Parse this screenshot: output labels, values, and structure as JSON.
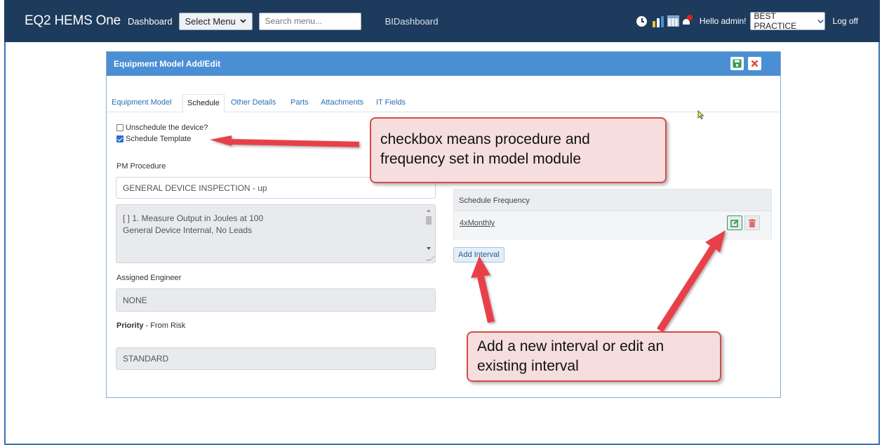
{
  "navbar": {
    "brand": "EQ2 HEMS One",
    "dashboard": "Dashboard",
    "select_menu": "Select Menu",
    "search_placeholder": "Search menu...",
    "bi_dashboard": "BIDashboard",
    "hello": "Hello admin!",
    "facility": "BEST PRACTICE",
    "log_off": "Log off"
  },
  "panel": {
    "title": "Equipment Model Add/Edit",
    "tabs": [
      "Equipment Model",
      "Schedule",
      "Other Details",
      "Parts",
      "Attachments",
      "IT Fields"
    ],
    "active_tab": "Schedule"
  },
  "schedule": {
    "unschedule_label": "Unschedule the device?",
    "unschedule_checked": false,
    "template_label": "Schedule Template",
    "template_checked": true,
    "pm_procedure_label": "PM Procedure",
    "pm_procedure_value": "GENERAL DEVICE INSPECTION - up",
    "procedure_lines": [
      "[ ] 1. Measure Output in Joules at 100",
      "General Device Internal, No Leads"
    ],
    "assigned_engineer_label": "Assigned Engineer",
    "assigned_engineer_value": "NONE",
    "priority_label": "Priority",
    "priority_suffix": " - From Risk",
    "priority_value": "STANDARD",
    "frequency_header": "Schedule Frequency",
    "frequency_item": "4xMonthly",
    "add_interval": "Add Interval"
  },
  "callouts": {
    "template_note_lines": [
      "checkbox means procedure and",
      "frequency set in model module"
    ],
    "interval_note_lines": [
      "Add a new interval or edit an",
      "existing interval"
    ]
  },
  "colors": {
    "navbar": "#1d3b5c",
    "panel_header": "#4a8fd3",
    "link": "#2a6fb5",
    "callout_border": "#d84a4a",
    "callout_fill": "#f6dede",
    "save_green": "#2e9b4f",
    "close_red": "#e0473c"
  }
}
